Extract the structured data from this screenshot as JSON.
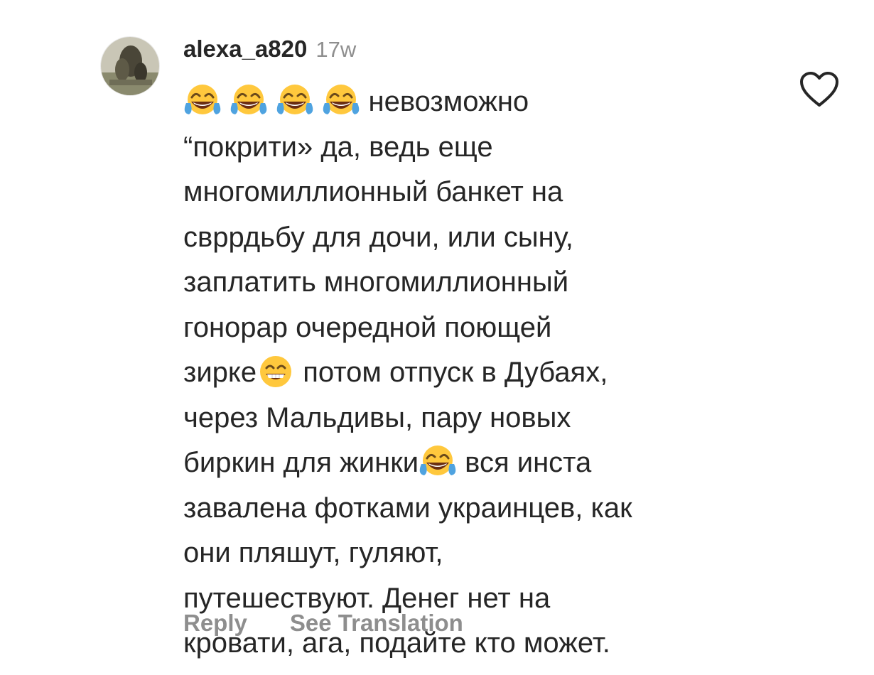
{
  "comment": {
    "username": "alexa_a820",
    "timestamp": "17w",
    "text_lines": [
      {
        "prefix_emojis": [
          "face-with-tears-of-joy",
          "face-with-tears-of-joy",
          "face-with-tears-of-joy",
          "face-with-tears-of-joy"
        ],
        "text": "невозможно"
      },
      {
        "text": "“покрити» да, ведь еще"
      },
      {
        "text": "многомиллионный банкет на"
      },
      {
        "text": "свррдьбу для дочи, или сыну,"
      },
      {
        "text": "заплатить многомиллионный"
      },
      {
        "text": "гонорар очередной поющей"
      },
      {
        "text": "зирке",
        "emoji": "grinning-face-with-smiling-eyes",
        "after": " потом отпуск в Дубаях,"
      },
      {
        "text": "через Мальдивы, пару новых"
      },
      {
        "text": "биркин для жинки",
        "emoji": "face-with-tears-of-joy",
        "after": " вся инста"
      },
      {
        "text": "завалена фотками украинцев, как"
      },
      {
        "text": "они пляшут, гуляют,"
      },
      {
        "text": "путешествуют. Денег нет на"
      },
      {
        "text": "кровати, ага, подайте кто может."
      }
    ]
  },
  "actions": {
    "reply_label": "Reply",
    "translate_label": "See Translation"
  },
  "icons": {
    "like": "heart-outline-icon",
    "avatar": "user-avatar"
  },
  "colors": {
    "text": "#262626",
    "muted": "#8e8e8e",
    "emoji_face": "#FFC83D",
    "emoji_tear": "#4FA3E0"
  }
}
